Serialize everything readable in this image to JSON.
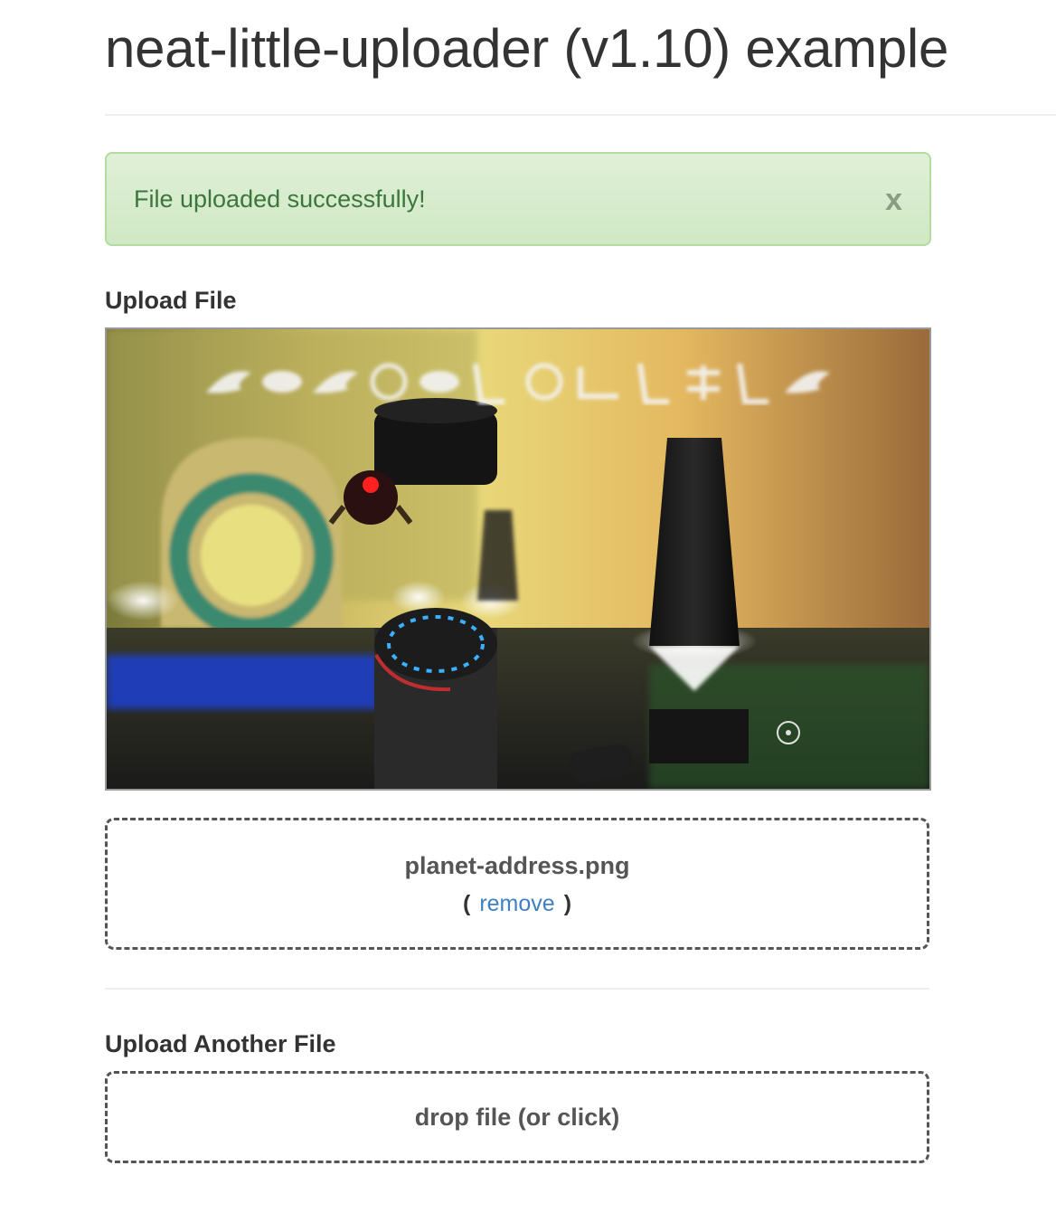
{
  "page": {
    "title": "neat-little-uploader (v1.10) example"
  },
  "alert": {
    "message": "File uploaded successfully!",
    "close_label": "x",
    "colors": {
      "background": "#dff0d8",
      "border": "#b3dca0",
      "text": "#3c763d"
    }
  },
  "upload_file": {
    "label": "Upload File",
    "preview_image": "planet-address screenshot (glyphs, portal, pillars)",
    "file_name": "planet-address.png",
    "paren_open": "(",
    "remove_label": "remove",
    "paren_close": ")"
  },
  "upload_another": {
    "label": "Upload Another File",
    "drop_label": "drop file (or click)"
  },
  "colors": {
    "link": "#3f7fc4",
    "dashed_border": "#555555"
  }
}
